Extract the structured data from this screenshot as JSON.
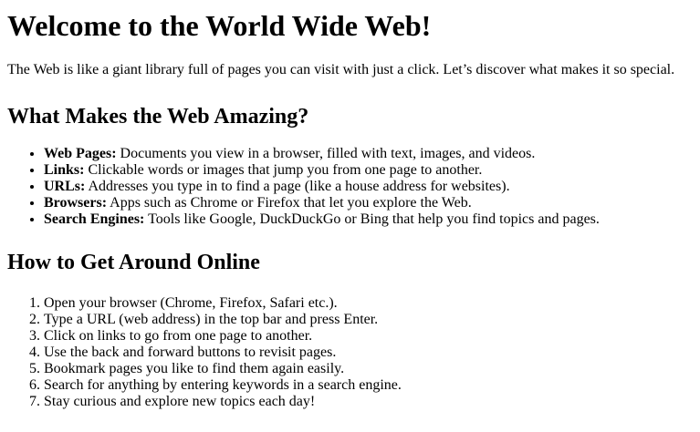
{
  "title": "Welcome to the World Wide Web!",
  "intro": "The Web is like a giant library full of pages you can visit with just a click. Let’s discover what makes it so special.",
  "section1": {
    "heading": "What Makes the Web Amazing?",
    "items": [
      {
        "term": "Web Pages:",
        "text": " Documents you view in a browser, filled with text, images, and videos."
      },
      {
        "term": "Links:",
        "text": " Clickable words or images that jump you from one page to another."
      },
      {
        "term": "URLs:",
        "text": " Addresses you type in to find a page (like a house address for websites)."
      },
      {
        "term": "Browsers:",
        "text": " Apps such as Chrome or Firefox that let you explore the Web."
      },
      {
        "term": "Search Engines:",
        "text": " Tools like Google, DuckDuckGo or Bing that help you find topics and pages."
      }
    ]
  },
  "section2": {
    "heading": "How to Get Around Online",
    "steps": [
      "Open your browser (Chrome, Firefox, Safari etc.).",
      "Type a URL (web address) in the top bar and press Enter.",
      "Click on links to go from one page to another.",
      "Use the back and forward buttons to revisit pages.",
      "Bookmark pages you like to find them again easily.",
      "Search for anything by entering keywords in a search engine.",
      "Stay curious and explore new topics each day!"
    ]
  }
}
